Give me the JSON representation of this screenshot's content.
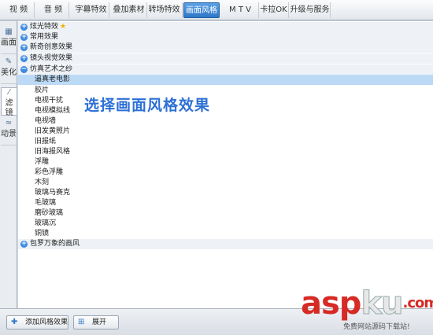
{
  "top_tabs": [
    {
      "label": "视 频",
      "active": false
    },
    {
      "label": "音 频",
      "active": false
    },
    {
      "label": "字幕特效",
      "active": false
    },
    {
      "label": "叠加素材",
      "active": false
    },
    {
      "label": "转场特效",
      "active": false
    },
    {
      "label": "画面风格",
      "active": true
    },
    {
      "label": "M T V",
      "active": false
    },
    {
      "label": "卡拉OK",
      "active": false
    },
    {
      "label": "升级与服务",
      "active": false
    }
  ],
  "side_tabs": [
    {
      "label": "画面",
      "icon": "grid-icon"
    },
    {
      "label": "美化",
      "icon": "brush-icon"
    },
    {
      "label": "滤镜",
      "icon": "magic-wand-icon",
      "active": true
    },
    {
      "label": "动景",
      "icon": "waves-icon"
    }
  ],
  "groups": {
    "g1": {
      "label": "炫光特效",
      "toggle": "+"
    },
    "g2": {
      "label": "常用效果",
      "toggle": "+"
    },
    "g3": {
      "label": "新奇创意效果",
      "toggle": "+"
    },
    "g4": {
      "label": "镜头视觉效果",
      "toggle": "+"
    },
    "g5": {
      "label": "仿真艺术之纱",
      "toggle": "−"
    },
    "g6": {
      "label": "包罗万象的画风",
      "toggle": "+"
    }
  },
  "items": [
    "逼真老电影",
    "胶片",
    "电视干扰",
    "电视模拟线",
    "电视墙",
    "旧发黄照片",
    "旧报纸",
    "旧海报风格",
    "浮雕",
    "彩色浮雕",
    "木刻",
    "玻璃马赛克",
    "毛玻璃",
    "磨砂玻璃",
    "玻璃沉",
    "铜镜"
  ],
  "overlay_text": "选择画面风格效果",
  "bottom": {
    "add_label": "添加风格效果",
    "expand_label": "展开"
  },
  "watermark": {
    "asp": "asp",
    "ku": "ku",
    "dot": ".",
    "com": "com",
    "sub": "免费网站源码下载站!"
  },
  "colors": {
    "accent": "#2f78c8",
    "selection": "#bcdaf6",
    "overlay_text": "#2c6fd6",
    "watermark_red": "#d62b25"
  }
}
